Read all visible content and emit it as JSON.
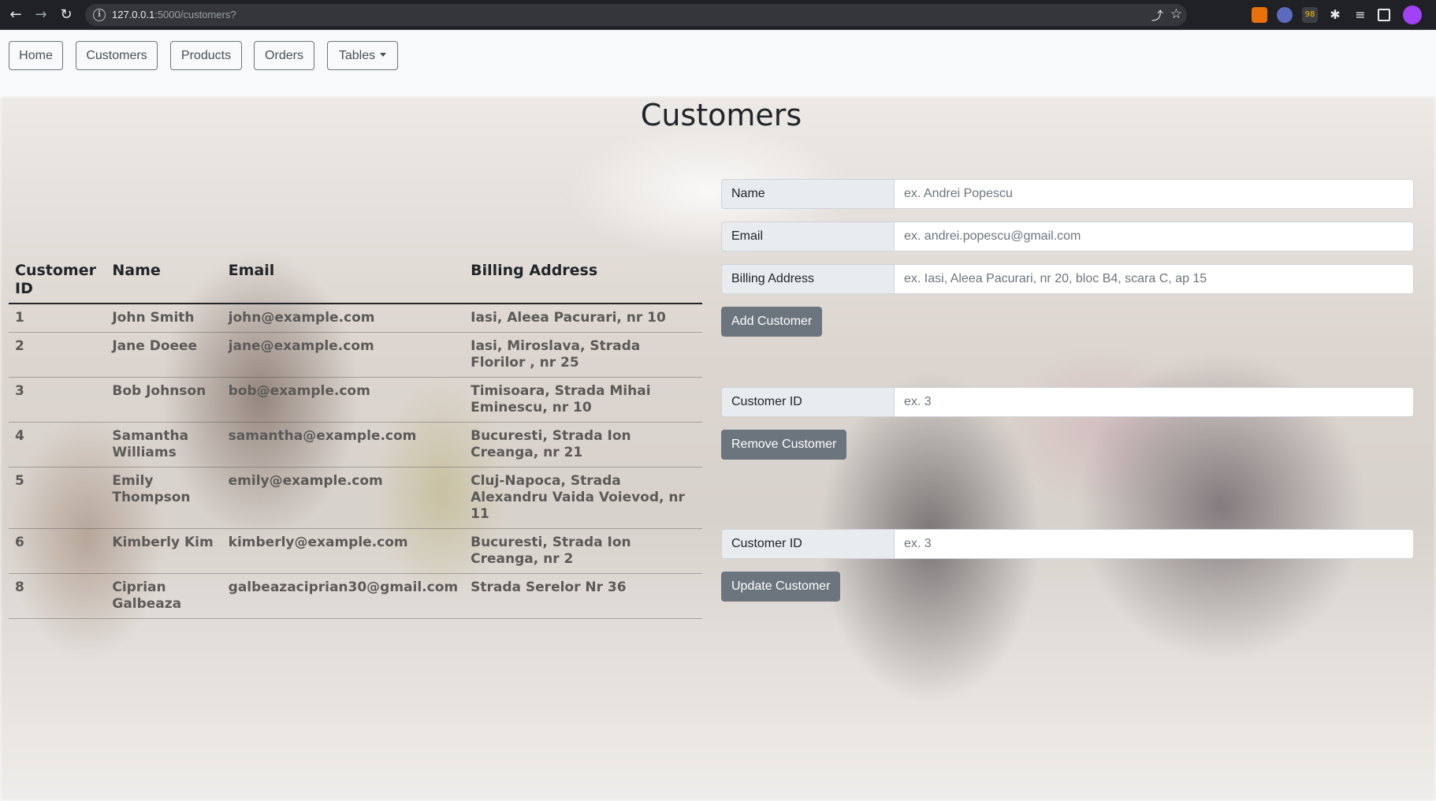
{
  "browser": {
    "url_host": "127.0.0.1",
    "url_path": ":5000/customers?",
    "extension_badge": "98"
  },
  "nav": {
    "home": "Home",
    "customers": "Customers",
    "products": "Products",
    "orders": "Orders",
    "tables": "Tables"
  },
  "page_title": "Customers",
  "table": {
    "headers": [
      "Customer ID",
      "Name",
      "Email",
      "Billing Address"
    ],
    "rows": [
      {
        "id": "1",
        "name": "John Smith",
        "email": "john@example.com",
        "address": "Iasi, Aleea Pacurari, nr 10"
      },
      {
        "id": "2",
        "name": "Jane Doeee",
        "email": "jane@example.com",
        "address": "Iasi, Miroslava, Strada Florilor , nr 25"
      },
      {
        "id": "3",
        "name": "Bob Johnson",
        "email": "bob@example.com",
        "address": "Timisoara, Strada Mihai Eminescu, nr 10"
      },
      {
        "id": "4",
        "name": "Samantha Williams",
        "email": "samantha@example.com",
        "address": "Bucuresti, Strada Ion Creanga, nr 21"
      },
      {
        "id": "5",
        "name": "Emily Thompson",
        "email": "emily@example.com",
        "address": "Cluj-Napoca, Strada Alexandru Vaida Voievod, nr 11"
      },
      {
        "id": "6",
        "name": "Kimberly Kim",
        "email": "kimberly@example.com",
        "address": "Bucuresti, Strada Ion Creanga, nr 2"
      },
      {
        "id": "8",
        "name": "Ciprian Galbeaza",
        "email": "galbeazaciprian30@gmail.com",
        "address": "Strada Serelor Nr 36"
      }
    ]
  },
  "add_form": {
    "name_label": "Name",
    "name_placeholder": "ex. Andrei Popescu",
    "email_label": "Email",
    "email_placeholder": "ex. andrei.popescu@gmail.com",
    "address_label": "Billing Address",
    "address_placeholder": "ex. Iasi, Aleea Pacurari, nr 20, bloc B4, scara C, ap 15",
    "button": "Add Customer"
  },
  "remove_form": {
    "id_label": "Customer ID",
    "id_placeholder": "ex. 3",
    "button": "Remove Customer"
  },
  "update_form": {
    "id_label": "Customer ID",
    "id_placeholder": "ex. 3",
    "button": "Update Customer"
  }
}
